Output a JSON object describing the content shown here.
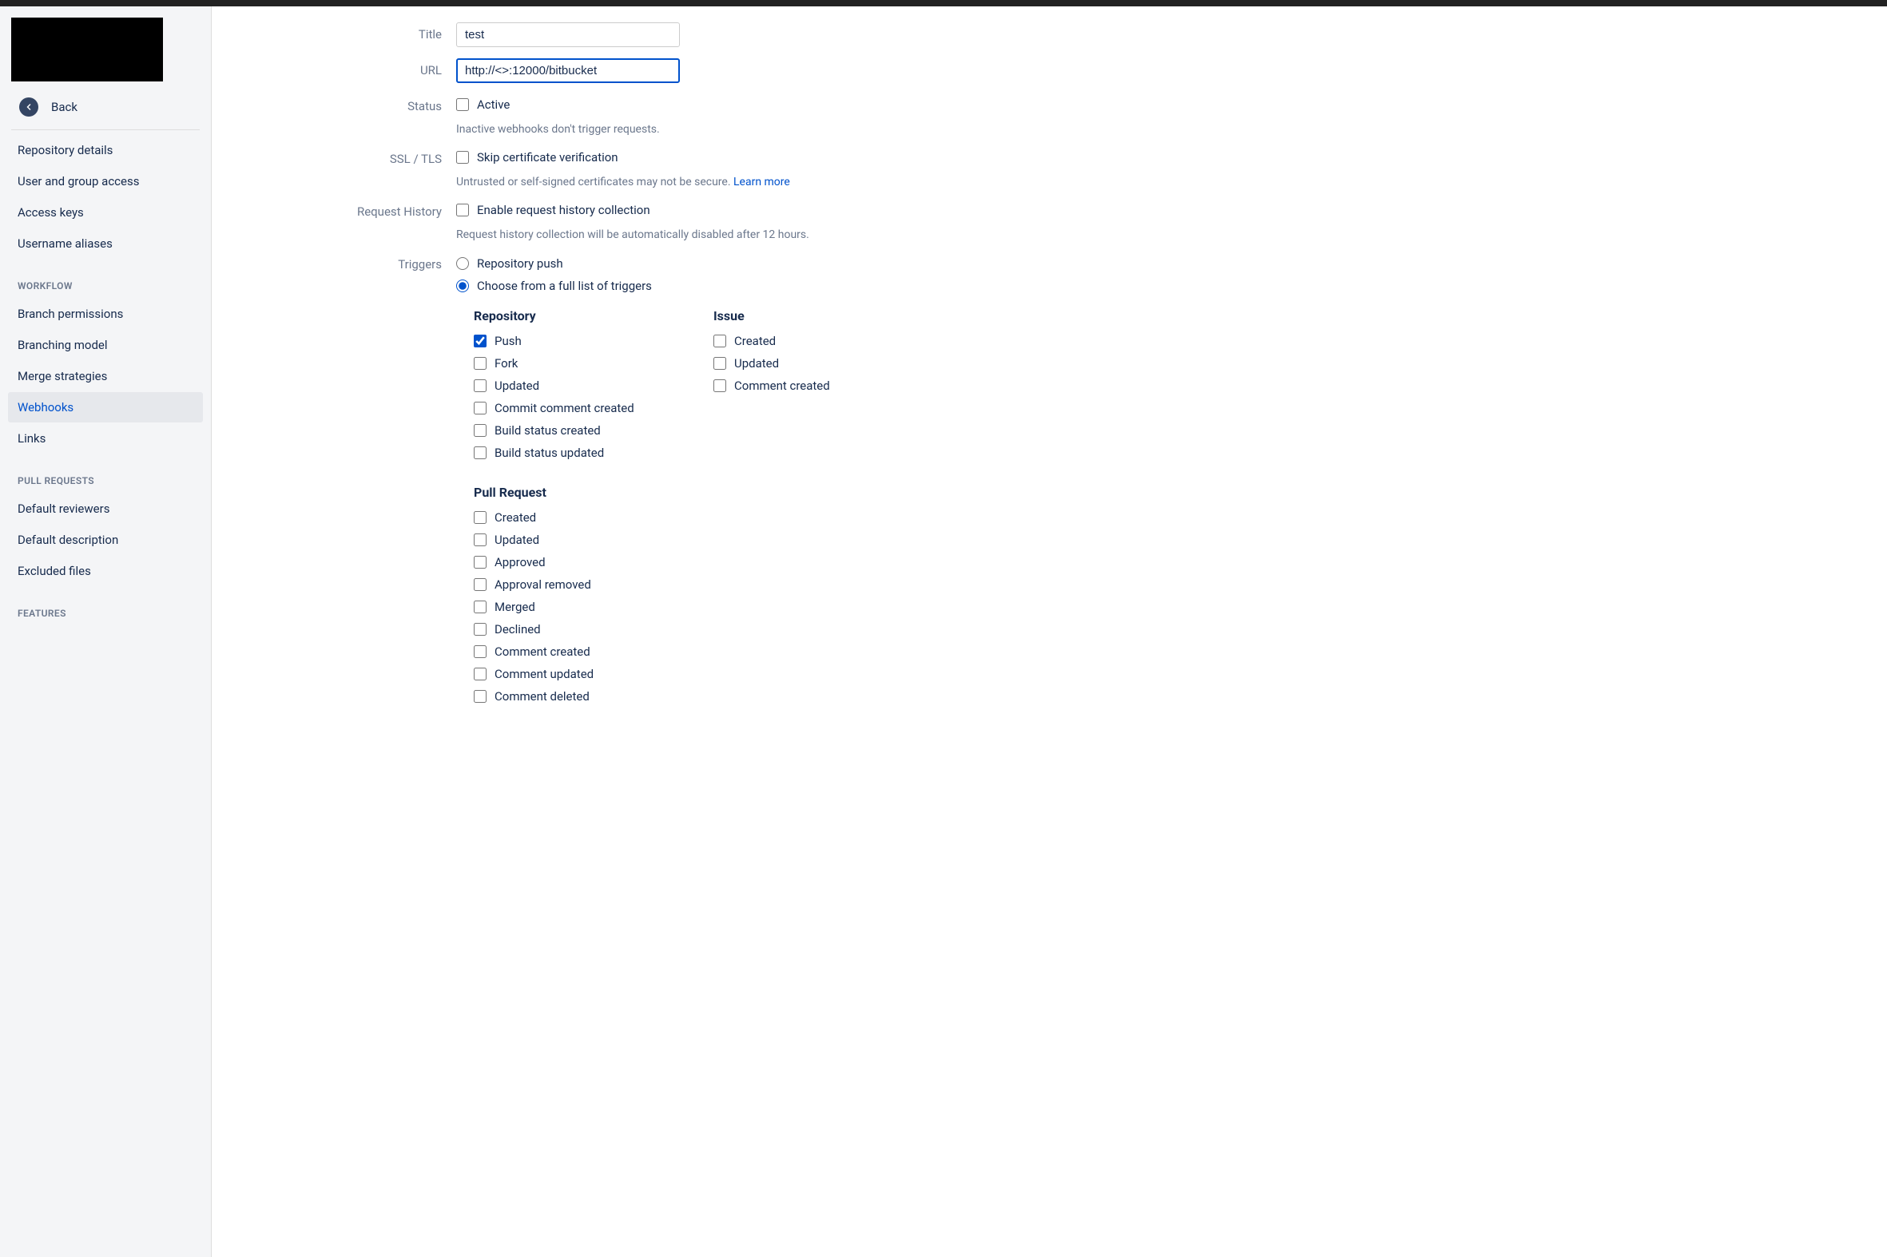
{
  "sidebar": {
    "back": "Back",
    "general": [
      {
        "label": "Repository details"
      },
      {
        "label": "User and group access"
      },
      {
        "label": "Access keys"
      },
      {
        "label": "Username aliases"
      }
    ],
    "sections": {
      "workflow_heading": "WORKFLOW",
      "workflow": [
        {
          "label": "Branch permissions"
        },
        {
          "label": "Branching model"
        },
        {
          "label": "Merge strategies"
        },
        {
          "label": "Webhooks",
          "selected": true
        },
        {
          "label": "Links"
        }
      ],
      "pr_heading": "PULL REQUESTS",
      "pr": [
        {
          "label": "Default reviewers"
        },
        {
          "label": "Default description"
        },
        {
          "label": "Excluded files"
        }
      ],
      "features_heading": "FEATURES"
    }
  },
  "form": {
    "title_label": "Title",
    "title_value": "test",
    "url_label": "URL",
    "url_value": "http://<>:12000/bitbucket",
    "status_label": "Status",
    "status_checkbox": "Active",
    "status_hint": "Inactive webhooks don't trigger requests.",
    "ssl_label": "SSL / TLS",
    "ssl_checkbox": "Skip certificate verification",
    "ssl_hint_text": "Untrusted or self-signed certificates may not be secure. ",
    "ssl_hint_link": "Learn more",
    "history_label": "Request History",
    "history_checkbox": "Enable request history collection",
    "history_hint": "Request history collection will be automatically disabled after 12 hours.",
    "triggers_label": "Triggers",
    "triggers_radio1": "Repository push",
    "triggers_radio2": "Choose from a full list of triggers",
    "triggers": {
      "repository_heading": "Repository",
      "repository": [
        {
          "label": "Push",
          "checked": true
        },
        {
          "label": "Fork"
        },
        {
          "label": "Updated"
        },
        {
          "label": "Commit comment created"
        },
        {
          "label": "Build status created"
        },
        {
          "label": "Build status updated"
        }
      ],
      "issue_heading": "Issue",
      "issue": [
        {
          "label": "Created"
        },
        {
          "label": "Updated"
        },
        {
          "label": "Comment created"
        }
      ],
      "pr_heading": "Pull Request",
      "pr": [
        {
          "label": "Created"
        },
        {
          "label": "Updated"
        },
        {
          "label": "Approved"
        },
        {
          "label": "Approval removed"
        },
        {
          "label": "Merged"
        },
        {
          "label": "Declined"
        },
        {
          "label": "Comment created"
        },
        {
          "label": "Comment updated"
        },
        {
          "label": "Comment deleted"
        }
      ]
    }
  }
}
